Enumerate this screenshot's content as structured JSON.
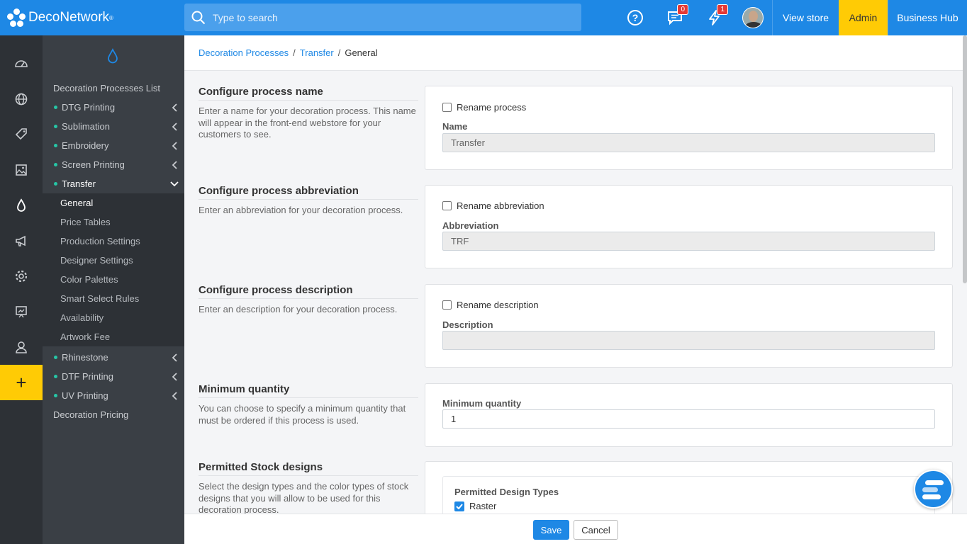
{
  "app": {
    "name": "DecoNetwork",
    "trademark": "®"
  },
  "search": {
    "placeholder": "Type to search"
  },
  "topbar": {
    "messages_badge": "0",
    "alerts_badge": "1",
    "view_store": "View store",
    "admin": "Admin",
    "business_hub": "Business Hub"
  },
  "rail_icons": [
    "dashboard-icon",
    "globe-icon",
    "tag-icon",
    "image-icon",
    "drop-icon",
    "megaphone-icon",
    "gear-icon",
    "chart-board-icon",
    "user-icon",
    "plus-icon"
  ],
  "nav": {
    "list_title": "Decoration Processes List",
    "items": [
      {
        "label": "DTG Printing"
      },
      {
        "label": "Sublimation"
      },
      {
        "label": "Embroidery"
      },
      {
        "label": "Screen Printing"
      },
      {
        "label": "Transfer"
      }
    ],
    "subitems": [
      "General",
      "Price Tables",
      "Production Settings",
      "Designer Settings",
      "Color Palettes",
      "Smart Select Rules",
      "Availability",
      "Artwork Fee"
    ],
    "items_after": [
      {
        "label": "Rhinestone"
      },
      {
        "label": "DTF Printing"
      },
      {
        "label": "UV Printing"
      }
    ],
    "pricing": "Decoration Pricing"
  },
  "breadcrumb": {
    "level1": "Decoration Processes",
    "level2": "Transfer",
    "current": "General",
    "sep": "/"
  },
  "sections": {
    "name": {
      "title": "Configure process name",
      "desc": "Enter a name for your decoration process. This name will appear in the front-end webstore for your customers to see.",
      "checkbox": "Rename process",
      "label": "Name",
      "value": "Transfer"
    },
    "abbr": {
      "title": "Configure process abbreviation",
      "desc": "Enter an abbreviation for your decoration process.",
      "checkbox": "Rename abbreviation",
      "label": "Abbreviation",
      "value": "TRF"
    },
    "desc": {
      "title": "Configure process description",
      "desc": "Enter an description for your decoration process.",
      "checkbox": "Rename description",
      "label": "Description",
      "value": ""
    },
    "minqty": {
      "title": "Minimum quantity",
      "desc": "You can choose to specify a minimum quantity that must be ordered if this process is used.",
      "label": "Minimum quantity",
      "value": "1"
    },
    "stock": {
      "title": "Permitted Stock designs",
      "desc": "Select the design types and the color types of stock designs that you will allow to be used for this decoration process.",
      "inner_title": "Permitted Design Types",
      "raster": "Raster"
    }
  },
  "footer": {
    "save": "Save",
    "cancel": "Cancel"
  },
  "colors": {
    "primary": "#1e88e5",
    "accent": "#ffcb05",
    "rail": "#2d3136",
    "nav": "#3a3f45",
    "dot": "#26c6a6"
  }
}
